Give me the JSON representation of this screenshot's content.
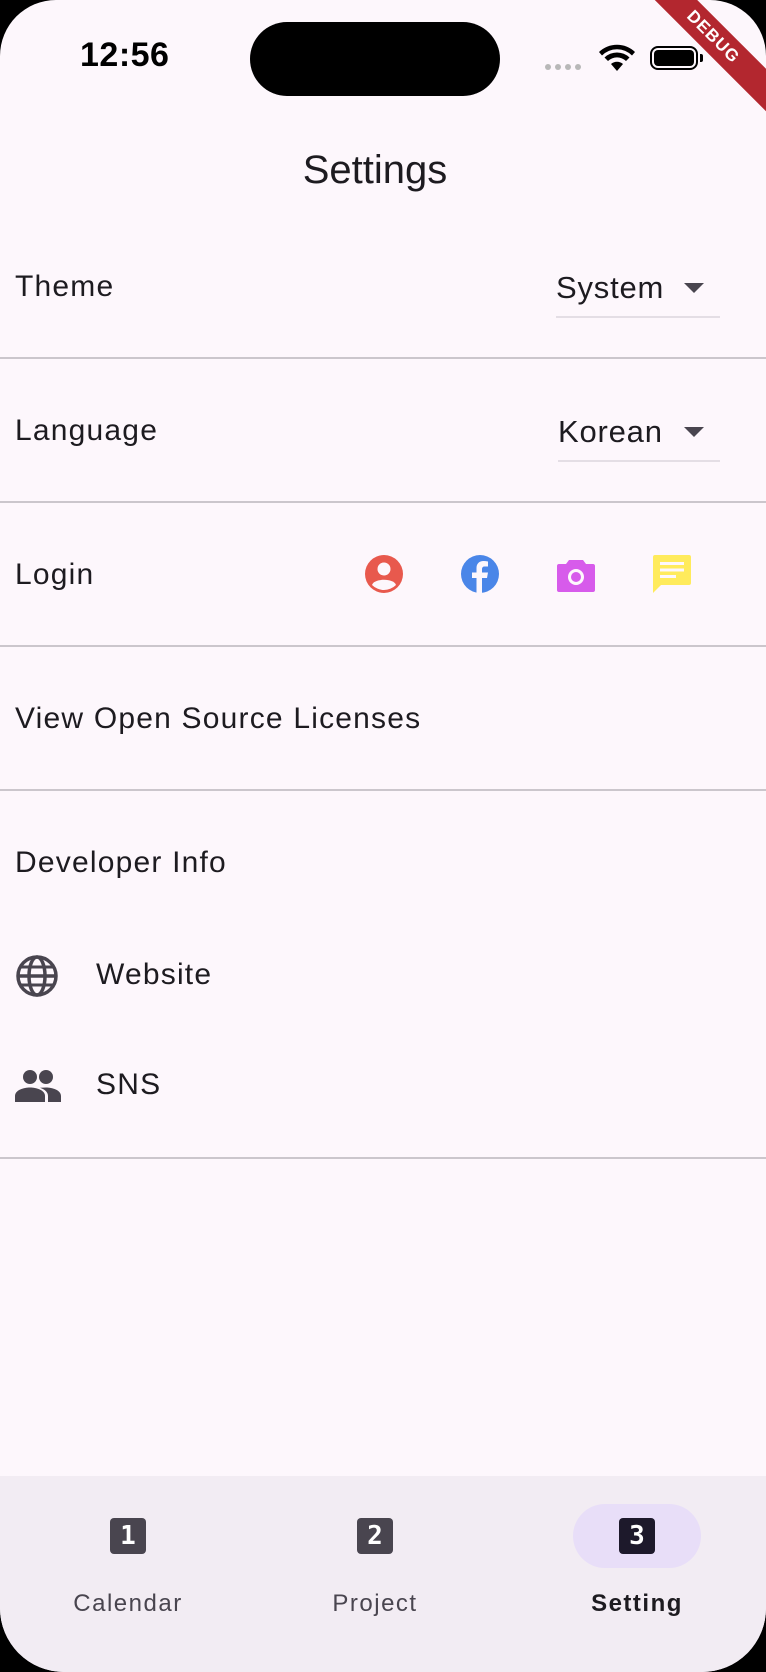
{
  "status_bar": {
    "time": "12:56",
    "debug_banner": "DEBUG"
  },
  "header": {
    "title": "Settings"
  },
  "settings": {
    "theme": {
      "label": "Theme",
      "value": "System"
    },
    "language": {
      "label": "Language",
      "value": "Korean"
    },
    "login": {
      "label": "Login",
      "providers": [
        {
          "icon": "account-circle-icon",
          "color": "#E8594D"
        },
        {
          "icon": "facebook-icon",
          "color": "#4A86E8"
        },
        {
          "icon": "camera-icon",
          "color": "#D75BEB"
        },
        {
          "icon": "chat-message-icon",
          "color": "#FFEB5C"
        }
      ]
    },
    "licenses": {
      "label": "View Open Source Licenses"
    },
    "developer": {
      "label": "Developer Info",
      "items": [
        {
          "icon": "globe-icon",
          "label": "Website"
        },
        {
          "icon": "people-icon",
          "label": "SNS"
        }
      ]
    }
  },
  "nav": {
    "items": [
      {
        "icon_text": "1",
        "label": "Calendar",
        "active": false
      },
      {
        "icon_text": "2",
        "label": "Project",
        "active": false
      },
      {
        "icon_text": "3",
        "label": "Setting",
        "active": true
      }
    ]
  },
  "colors": {
    "background": "#FDF7FC",
    "navbar": "#F2ECF3",
    "active_pill": "#E8DEF8",
    "divider": "#CBC6CC"
  }
}
